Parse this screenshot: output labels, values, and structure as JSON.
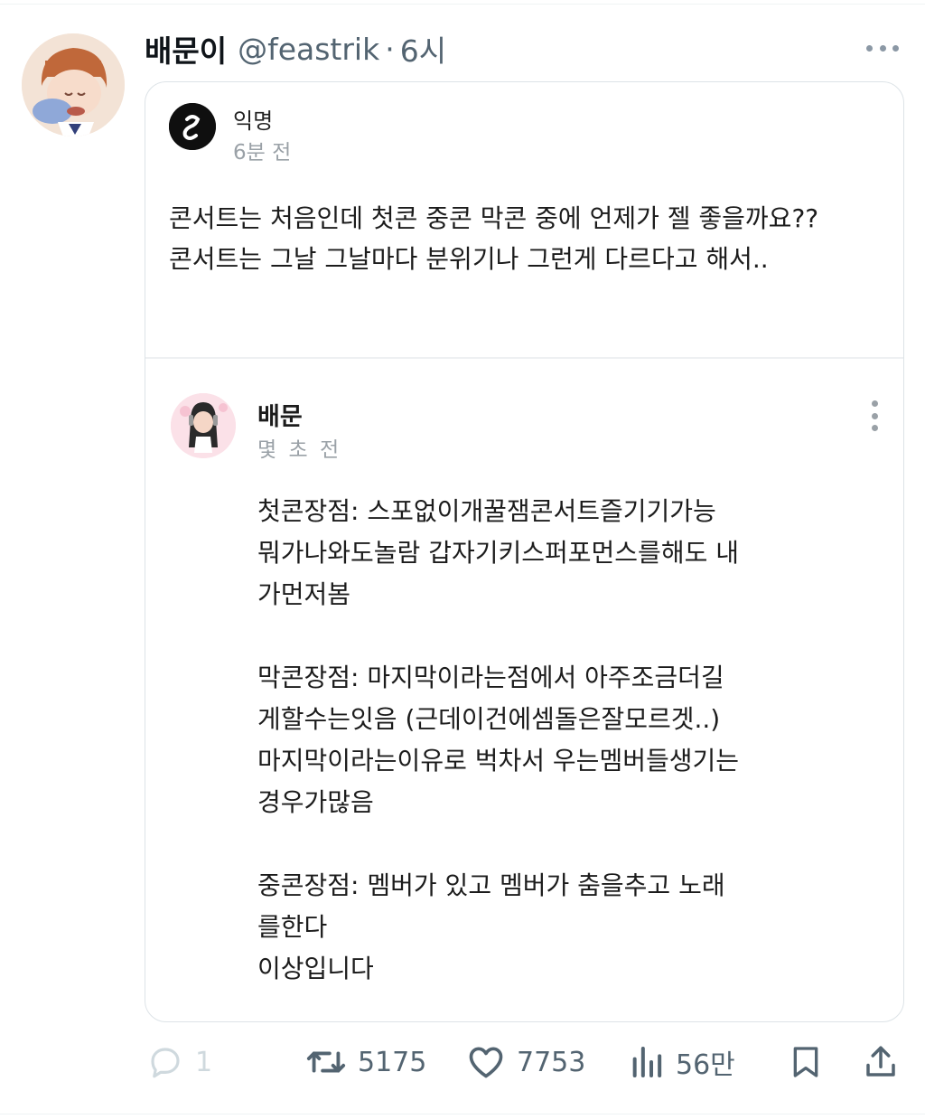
{
  "tweet": {
    "display_name": "배문이",
    "handle": "@feastrik",
    "separator": "·",
    "time": "6시"
  },
  "quote": {
    "author": "익명",
    "time": "6분 전",
    "text": "콘서트는 처음인데 첫콘 중콘 막콘 중에 언제가 젤 좋을까요??\n콘서트는 그날 그날마다 분위기나 그런게 다르다고 해서.."
  },
  "reply": {
    "author": "배문",
    "time": "몇 초 전",
    "paragraphs": [
      "첫콘장점: 스포없이개꿀잼콘서트즐기기가능\n뭐가나와도놀람 갑자기키스퍼포먼스를해도 내\n가먼저봄",
      "막콘장점: 마지막이라는점에서 아주조금더길\n게할수는잇음 (근데이건에셈돌은잘모르겟..)\n마지막이라는이유로 벅차서 우는멤버들생기는\n경우가많음",
      "중콘장점: 멤버가 있고 멤버가 춤을추고 노래\n를한다\n이상입니다"
    ]
  },
  "actions": {
    "replies": "1",
    "retweets": "5175",
    "likes": "7753",
    "views": "56만"
  },
  "icons": {
    "more": "more-horizontal-icon",
    "reply": "reply-bubble-icon",
    "retweet": "retweet-icon",
    "like": "heart-icon",
    "views": "views-bar-chart-icon",
    "bookmark": "bookmark-icon",
    "share": "share-upload-icon"
  },
  "colors": {
    "text_primary": "#0f1419",
    "text_secondary": "#536471",
    "border": "#dde3e7"
  }
}
